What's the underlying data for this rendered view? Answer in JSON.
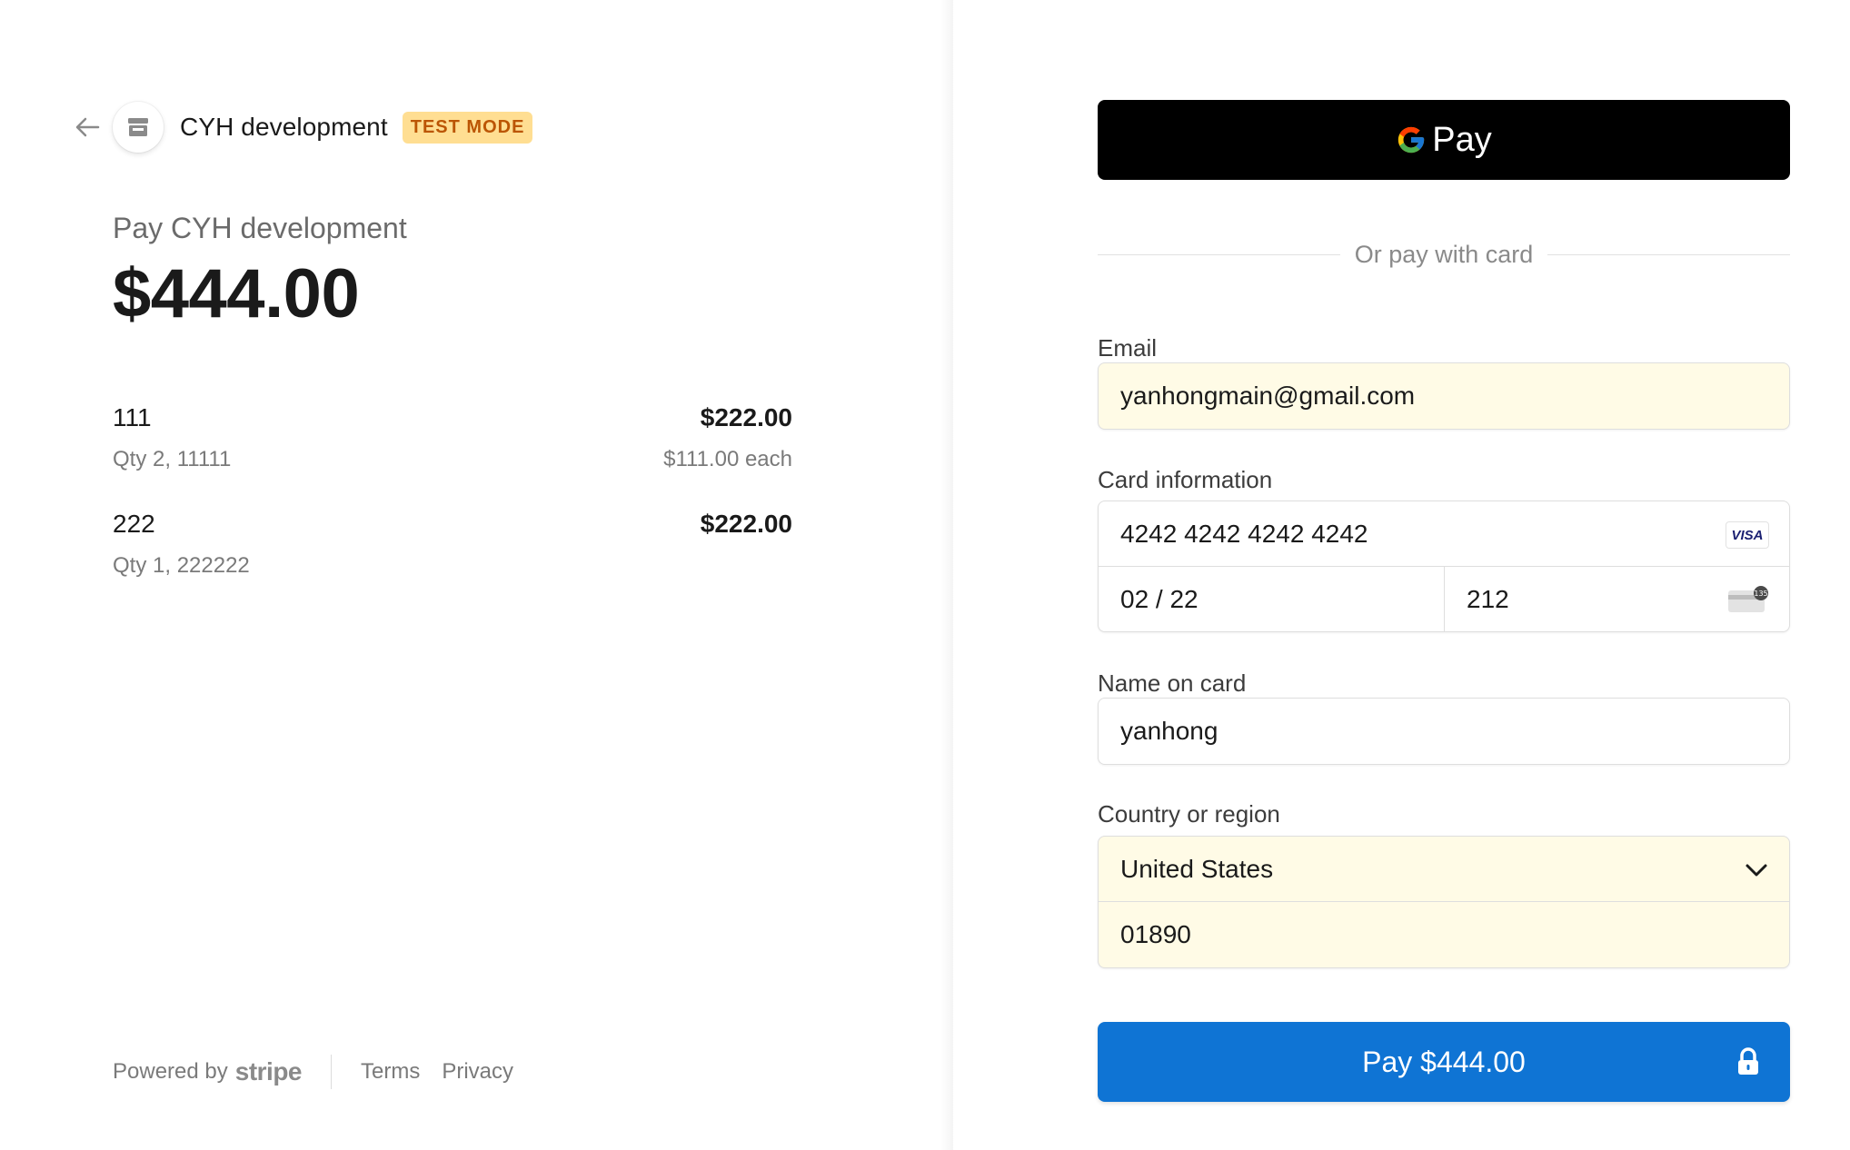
{
  "merchant": {
    "name": "CYH development",
    "badge": "TEST MODE"
  },
  "summary": {
    "pay_to": "Pay CYH development",
    "total": "$444.00"
  },
  "line_items": [
    {
      "name": "111",
      "price": "$222.00",
      "meta": "Qty 2, 11111",
      "unit_price": "$111.00 each"
    },
    {
      "name": "222",
      "price": "$222.00",
      "meta": "Qty 1, 222222",
      "unit_price": ""
    }
  ],
  "footer": {
    "powered_by": "Powered by",
    "brand": "stripe",
    "terms": "Terms",
    "privacy": "Privacy"
  },
  "wallet": {
    "gpay_label": "Pay"
  },
  "divider_text": "Or pay with card",
  "form": {
    "email": {
      "label": "Email",
      "value": "yanhongmain@gmail.com"
    },
    "card": {
      "label": "Card information",
      "number": "4242 4242 4242 4242",
      "expiry": "02 / 22",
      "cvc": "212",
      "brand_icon": "VISA"
    },
    "name": {
      "label": "Name on card",
      "value": "yanhong"
    },
    "country": {
      "label": "Country or region",
      "selected": "United States",
      "zip": "01890"
    }
  },
  "pay_button": {
    "label": "Pay $444.00"
  },
  "colors": {
    "pay_button": "#0f74d4",
    "badge_bg": "#ffde92",
    "badge_text": "#bb5504",
    "autofill_bg": "#fffbe6"
  }
}
